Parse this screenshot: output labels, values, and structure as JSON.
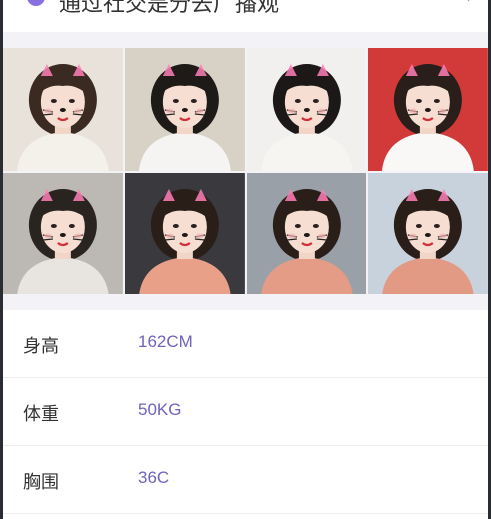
{
  "header": {
    "title": "通过社交是分去广播观",
    "icon": "app-icon",
    "chevron": "chevron-right-icon"
  },
  "gallery": {
    "photos": [
      {
        "label": "photo-1",
        "bg": "#e8e2da",
        "hair": "#3a2a22",
        "top": "#f4f0ea"
      },
      {
        "label": "photo-2",
        "bg": "#d8d2c6",
        "hair": "#1e1a18",
        "top": "#f6f4f2"
      },
      {
        "label": "photo-3",
        "bg": "#f2f0ee",
        "hair": "#1c1818",
        "top": "#f7f5f2"
      },
      {
        "label": "photo-4",
        "bg": "#d23a3a",
        "hair": "#2a1e1a",
        "top": "#faf8f6"
      },
      {
        "label": "photo-5",
        "bg": "#bcb8b4",
        "hair": "#2a2420",
        "top": "#e8e4e0"
      },
      {
        "label": "photo-6",
        "bg": "#3a3a3e",
        "hair": "#2a1e18",
        "top": "#e8a088"
      },
      {
        "label": "photo-7",
        "bg": "#9aa0a8",
        "hair": "#2a1e18",
        "top": "#e49c86"
      },
      {
        "label": "photo-8",
        "bg": "#c8d2dc",
        "hair": "#2a1e18",
        "top": "#e29a84"
      }
    ]
  },
  "profile": {
    "rows": [
      {
        "label": "身高",
        "value": "162CM"
      },
      {
        "label": "体重",
        "value": "50KG"
      },
      {
        "label": "胸围",
        "value": "36C"
      }
    ]
  },
  "colors": {
    "accent": "#6f64b8",
    "divider": "#ececf1",
    "section_bg": "#f2f2f7"
  }
}
